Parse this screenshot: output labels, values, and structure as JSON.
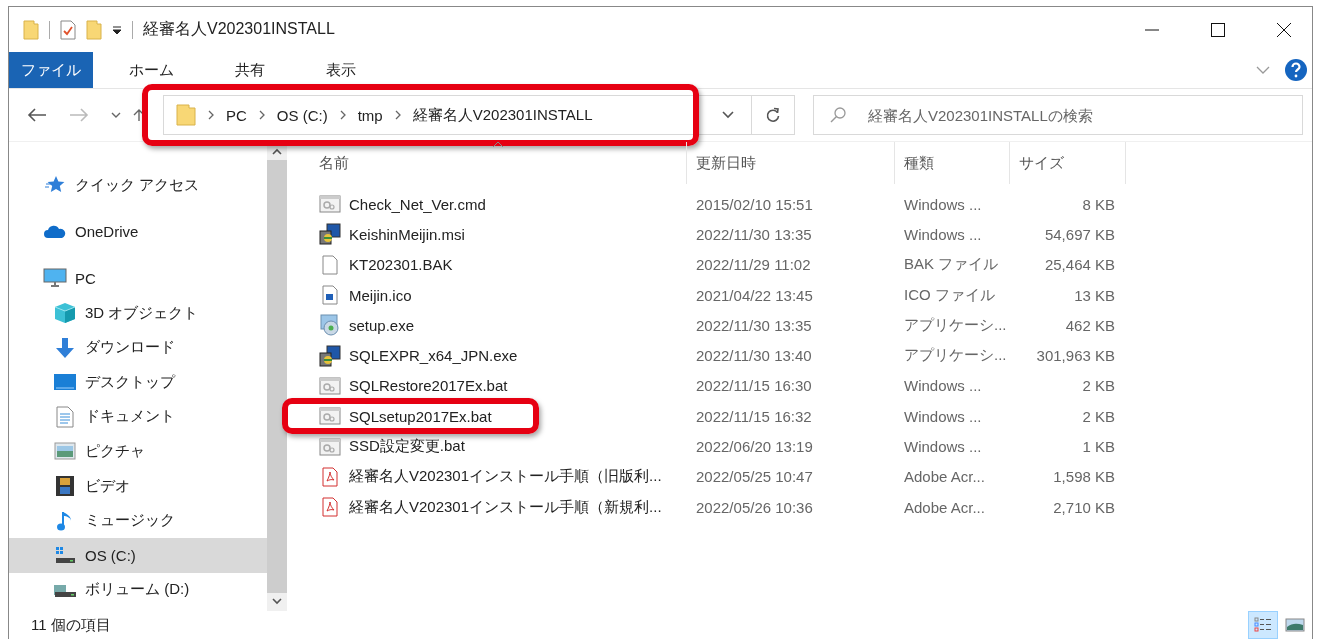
{
  "window": {
    "title": "経審名人V202301INSTALL"
  },
  "ribbon_tabs": [
    {
      "label": "ファイル",
      "selected": true
    },
    {
      "label": "ホーム",
      "selected": false
    },
    {
      "label": "共有",
      "selected": false
    },
    {
      "label": "表示",
      "selected": false
    }
  ],
  "address_bar": {
    "path": [
      "PC",
      "OS (C:)",
      "tmp",
      "経審名人V202301INSTALL"
    ],
    "highlighted": true
  },
  "search": {
    "placeholder": "経審名人V202301INSTALLの検索"
  },
  "sidebar": {
    "items": [
      {
        "label": "クイック アクセス",
        "kind": "star",
        "selected": false
      },
      {
        "label": "OneDrive",
        "kind": "cloud",
        "selected": false
      },
      {
        "label": "PC",
        "kind": "monitor",
        "selected": false,
        "children": [
          {
            "label": "3D オブジェクト",
            "kind": "cube",
            "selected": false
          },
          {
            "label": "ダウンロード",
            "kind": "download",
            "selected": false
          },
          {
            "label": "デスクトップ",
            "kind": "desktop",
            "selected": false
          },
          {
            "label": "ドキュメント",
            "kind": "document",
            "selected": false
          },
          {
            "label": "ピクチャ",
            "kind": "pictures",
            "selected": false
          },
          {
            "label": "ビデオ",
            "kind": "video",
            "selected": false
          },
          {
            "label": "ミュージック",
            "kind": "music",
            "selected": false
          },
          {
            "label": "OS (C:)",
            "kind": "drive",
            "selected": true
          },
          {
            "label": "ボリューム (D:)",
            "kind": "volume",
            "selected": false
          }
        ]
      }
    ]
  },
  "columns": [
    {
      "label": "名前",
      "sorted": true
    },
    {
      "label": "更新日時",
      "sorted": false
    },
    {
      "label": "種類",
      "sorted": false
    },
    {
      "label": "サイズ",
      "sorted": false
    }
  ],
  "files": [
    {
      "name": "Check_Net_Ver.cmd",
      "modified": "2015/02/10 15:51",
      "type": "Windows ...",
      "size": "8 KB",
      "kind": "script",
      "highlighted": false
    },
    {
      "name": "KeishinMeijin.msi",
      "modified": "2022/11/30 13:35",
      "type": "Windows ...",
      "size": "54,697 KB",
      "kind": "installer",
      "highlighted": false
    },
    {
      "name": "KT202301.BAK",
      "modified": "2022/11/29 11:02",
      "type": "BAK ファイル",
      "size": "25,464 KB",
      "kind": "blank",
      "highlighted": false
    },
    {
      "name": "Meijin.ico",
      "modified": "2021/04/22 13:45",
      "type": "ICO ファイル",
      "size": "13 KB",
      "kind": "image",
      "highlighted": false
    },
    {
      "name": "setup.exe",
      "modified": "2022/11/30 13:35",
      "type": "アプリケーシ...",
      "size": "462 KB",
      "kind": "setup",
      "highlighted": false
    },
    {
      "name": "SQLEXPR_x64_JPN.exe",
      "modified": "2022/11/30 13:40",
      "type": "アプリケーシ...",
      "size": "301,963 KB",
      "kind": "installer",
      "highlighted": false
    },
    {
      "name": "SQLRestore2017Ex.bat",
      "modified": "2022/11/15 16:30",
      "type": "Windows ...",
      "size": "2 KB",
      "kind": "script",
      "highlighted": false
    },
    {
      "name": "SQLsetup2017Ex.bat",
      "modified": "2022/11/15 16:32",
      "type": "Windows ...",
      "size": "2 KB",
      "kind": "script",
      "highlighted": true
    },
    {
      "name": "SSD設定変更.bat",
      "modified": "2022/06/20 13:19",
      "type": "Windows ...",
      "size": "1 KB",
      "kind": "script",
      "highlighted": false
    },
    {
      "name": "経審名人V202301インストール手順（旧版利...",
      "modified": "2022/05/25 10:47",
      "type": "Adobe Acr...",
      "size": "1,598 KB",
      "kind": "pdf",
      "highlighted": false
    },
    {
      "name": "経審名人V202301インストール手順（新規利...",
      "modified": "2022/05/26 10:36",
      "type": "Adobe Acr...",
      "size": "2,710 KB",
      "kind": "pdf",
      "highlighted": false
    }
  ],
  "status_bar": {
    "item_count": "11 個の項目"
  },
  "view_buttons": [
    {
      "kind": "details",
      "selected": true
    },
    {
      "kind": "large-icons",
      "selected": false
    }
  ]
}
